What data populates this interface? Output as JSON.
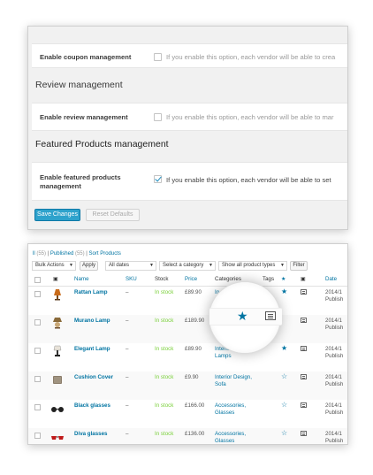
{
  "settings": {
    "coupon": {
      "label": "Enable coupon management",
      "desc": "If you enable this option, each vendor will be able to crea"
    },
    "review_heading": "Review management",
    "review": {
      "label": "Enable review management",
      "desc": "If you enable this option, each vendor will be able to mar"
    },
    "featured_heading": "Featured Products management",
    "featured": {
      "label_line1": "Enable featured products",
      "label_line2": "management",
      "desc": "If you enable this option, each vendor will be able to set"
    },
    "save_label": "Save Changes",
    "reset_label": "Reset Defaults"
  },
  "products": {
    "filters": {
      "all_label": "ll",
      "all_count": "(55)",
      "published_label": "Published",
      "published_count": "(55)",
      "sort_label": "Sort Products",
      "separator": "|"
    },
    "toolbar": {
      "bulk_actions": "Bulk Actions",
      "apply": "Apply",
      "dates": "All dates",
      "category": "Select a category",
      "types": "Show all product types",
      "filter": "Filter"
    },
    "columns": {
      "name": "Name",
      "sku": "SKU",
      "stock": "Stock",
      "price": "Price",
      "categories": "Categories",
      "tags": "Tags",
      "date": "Date"
    },
    "rows": [
      {
        "name": "Rattan Lamp",
        "sku": "–",
        "stock": "In stock",
        "price": "£89.90",
        "cat1": "In",
        "cat2": "",
        "date1": "2014/1",
        "date2": "Publish",
        "featured": "★"
      },
      {
        "name": "Murano Lamp",
        "sku": "–",
        "stock": "In stock",
        "price": "£189.90",
        "cat1": "",
        "cat2": "",
        "date1": "2014/1",
        "date2": "Publish",
        "featured": "★"
      },
      {
        "name": "Elegant Lamp",
        "sku": "–",
        "stock": "In stock",
        "price": "£89.90",
        "cat1": "Interior Design,",
        "cat2": "Lamps",
        "date1": "2014/1",
        "date2": "Publish",
        "featured": "★"
      },
      {
        "name": "Cushion Cover",
        "sku": "–",
        "stock": "In stock",
        "price": "£9.90",
        "cat1": "Interior Design,",
        "cat2": "Sofa",
        "date1": "2014/1",
        "date2": "Publish",
        "featured": "☆"
      },
      {
        "name": "Black glasses",
        "sku": "–",
        "stock": "In stock",
        "price": "£166.00",
        "cat1": "Accessories,",
        "cat2": "Glasses",
        "date1": "2014/1",
        "date2": "Publish",
        "featured": "☆"
      },
      {
        "name": "Diva glasses",
        "sku": "–",
        "stock": "In stock",
        "price": "£136.00",
        "cat1": "Accessories,",
        "cat2": "Glasses",
        "date1": "2014/1",
        "date2": "Publish",
        "featured": "☆"
      }
    ],
    "magnifier_star": "★",
    "header_star": "★",
    "header_cart": "🛒"
  },
  "colors": {
    "link": "#0074a2",
    "primary_button": "#2ea2cc",
    "in_stock": "#7ad03a"
  }
}
